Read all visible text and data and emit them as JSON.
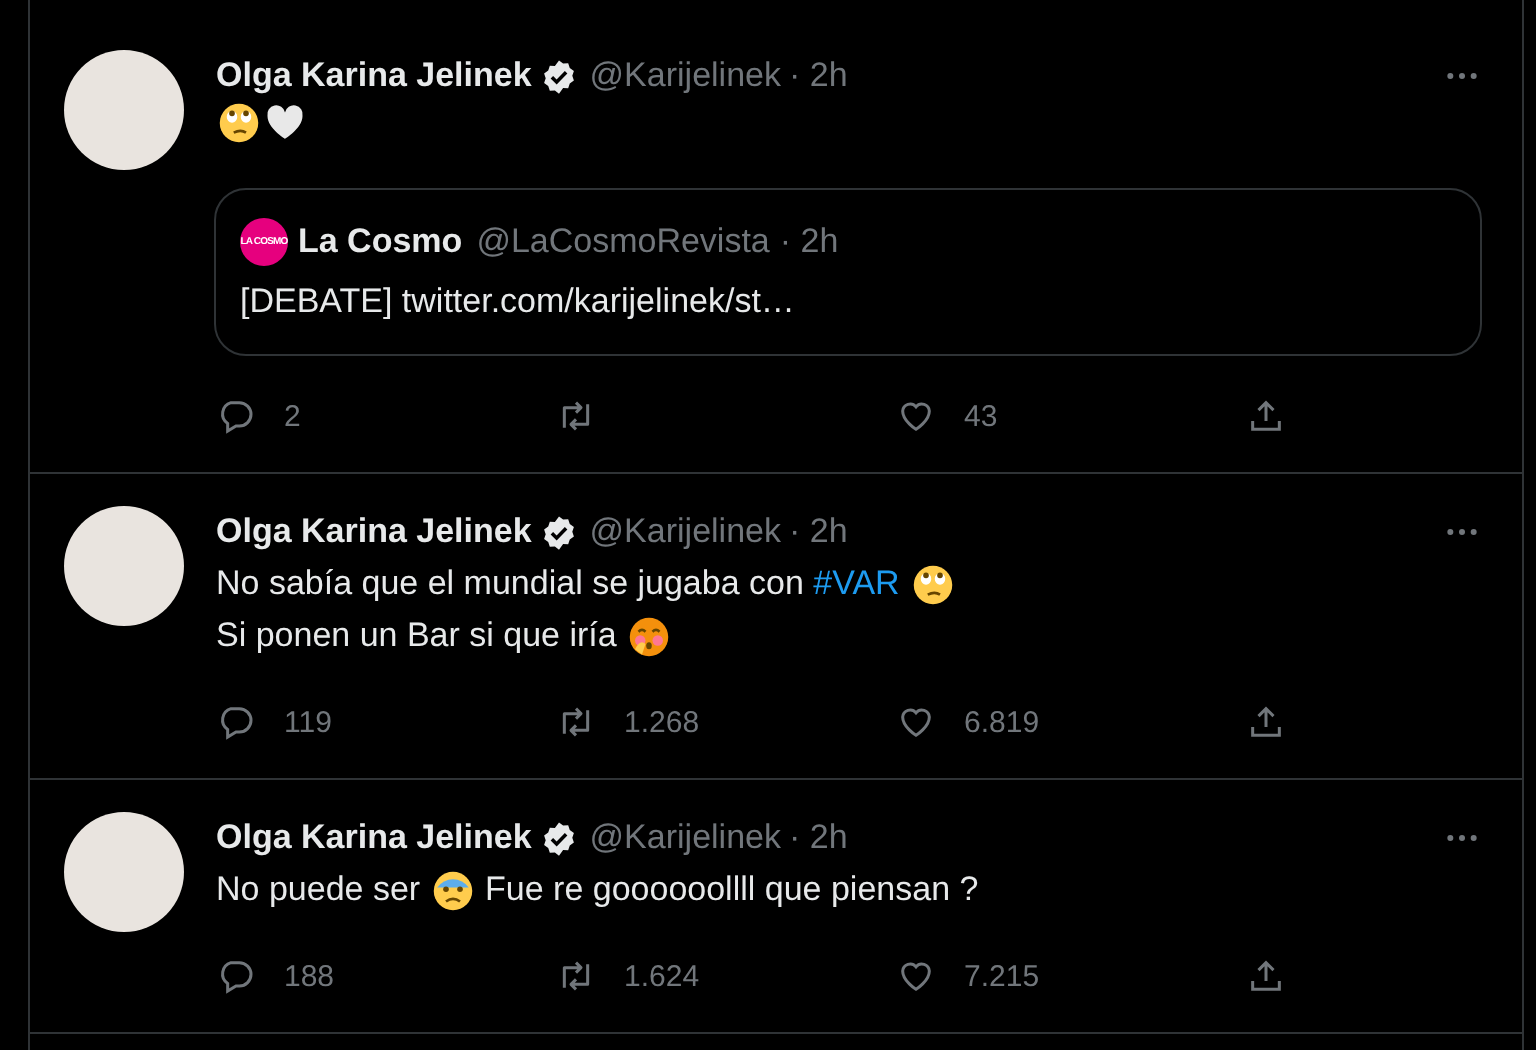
{
  "tweets": [
    {
      "author": {
        "name": "Olga Karina Jelinek",
        "verified": true,
        "handle": "@Karijelinek",
        "time": "· 2h"
      },
      "lines": [
        [
          {
            "kind": "face-rolling-eyes"
          },
          {
            "kind": "heart-white"
          }
        ]
      ],
      "quote": {
        "author": "La Cosmo",
        "handle": "@LaCosmoRevista",
        "time": "· 2h",
        "logo": "LA COSMO",
        "text": "[DEBATE] twitter.com/karijelinek/st…"
      },
      "replies": "2",
      "likes": "43"
    },
    {
      "author": {
        "name": "Olga Karina Jelinek",
        "verified": true,
        "handle": "@Karijelinek",
        "time": "· 2h"
      },
      "lines": [
        [
          {
            "kind": "text",
            "text": "No sabía que el mundial se jugaba con "
          },
          {
            "kind": "hashtag",
            "text": "#VAR"
          },
          {
            "kind": "face-rolling-eyes"
          }
        ],
        [
          {
            "kind": "text",
            "text": "Si ponen un Bar si que iría "
          },
          {
            "kind": "face-blushing"
          }
        ]
      ],
      "replies": "119",
      "retweets": "1.268",
      "likes": "6.819"
    },
    {
      "author": {
        "name": "Olga Karina Jelinek",
        "verified": true,
        "handle": "@Karijelinek",
        "time": "· 2h"
      },
      "lines": [
        [
          {
            "kind": "text",
            "text": "No puede ser "
          },
          {
            "kind": "face-fearful"
          },
          {
            "kind": "text",
            "text": " Fue re goooooollll que piensan ?"
          }
        ]
      ],
      "replies": "188",
      "retweets": "1.624",
      "likes": "7.215"
    }
  ]
}
